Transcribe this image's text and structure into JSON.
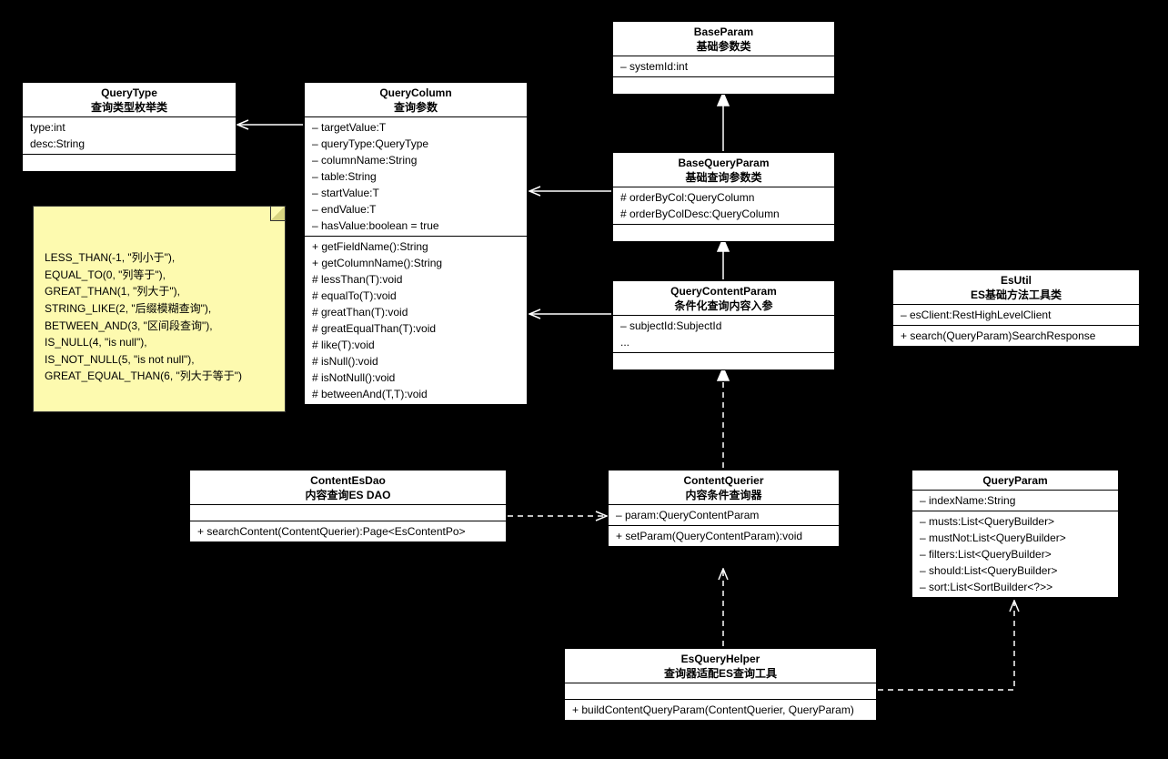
{
  "classes": {
    "QueryType": {
      "name": "QueryType",
      "sub": "查询类型枚举类",
      "attrs": [
        "type:int",
        "desc:String"
      ],
      "ops": []
    },
    "QueryColumn": {
      "name": "QueryColumn",
      "sub": "查询参数",
      "attrs": [
        "– targetValue:T",
        "– queryType:QueryType",
        "– columnName:String",
        "– table:String",
        "– startValue:T",
        "– endValue:T",
        "– hasValue:boolean = true"
      ],
      "ops": [
        "+ getFieldName():String",
        "+ getColumnName():String",
        "# lessThan(T):void",
        "# equalTo(T):void",
        "# greatThan(T):void",
        "# greatEqualThan(T):void",
        "# like(T):void",
        "# isNull():void",
        "# isNotNull():void",
        "# betweenAnd(T,T):void"
      ]
    },
    "BaseParam": {
      "name": "BaseParam",
      "sub": "基础参数类",
      "attrs": [
        "– systemId:int"
      ],
      "ops": []
    },
    "BaseQueryParam": {
      "name": "BaseQueryParam",
      "sub": "基础查询参数类",
      "attrs": [
        "# orderByCol:QueryColumn",
        "# orderByColDesc:QueryColumn"
      ],
      "ops": []
    },
    "QueryContentParam": {
      "name": "QueryContentParam",
      "sub": "条件化查询内容入参",
      "attrs": [
        "– subjectId:SubjectId",
        "..."
      ],
      "ops": []
    },
    "EsUtil": {
      "name": "EsUtil",
      "sub": "ES基础方法工具类",
      "attrs": [
        "– esClient:RestHighLevelClient"
      ],
      "ops": [
        "+ search(QueryParam)SearchResponse"
      ]
    },
    "ContentEsDao": {
      "name": "ContentEsDao",
      "sub": "内容查询ES DAO",
      "attrs": [],
      "ops": [
        "+ searchContent(ContentQuerier):Page<EsContentPo>"
      ]
    },
    "ContentQuerier": {
      "name": "ContentQuerier",
      "sub": "内容条件查询器",
      "attrs": [
        "– param:QueryContentParam"
      ],
      "ops": [
        "+ setParam(QueryContentParam):void"
      ]
    },
    "QueryParam": {
      "name": "QueryParam",
      "sub": "",
      "attrs1": [
        "– indexName:String"
      ],
      "attrs2": [
        "– musts:List<QueryBuilder>",
        "– mustNot:List<QueryBuilder>",
        "– filters:List<QueryBuilder>",
        "– should:List<QueryBuilder>",
        "– sort:List<SortBuilder<?>>"
      ]
    },
    "EsQueryHelper": {
      "name": "EsQueryHelper",
      "sub": "查询器适配ES查询工具",
      "attrs": [],
      "ops": [
        "+ buildContentQueryParam(ContentQuerier, QueryParam)"
      ]
    }
  },
  "note": {
    "lines": [
      "LESS_THAN(-1, \"列小于\"),",
      "EQUAL_TO(0, \"列等于\"),",
      "GREAT_THAN(1, \"列大于\"),",
      "STRING_LIKE(2, \"后缀模糊查询\"),",
      "BETWEEN_AND(3, \"区间段查询\"),",
      "IS_NULL(4, \"is null\"),",
      "IS_NOT_NULL(5, \"is not null\"),",
      "GREAT_EQUAL_THAN(6, \"列大于等于\")"
    ]
  }
}
